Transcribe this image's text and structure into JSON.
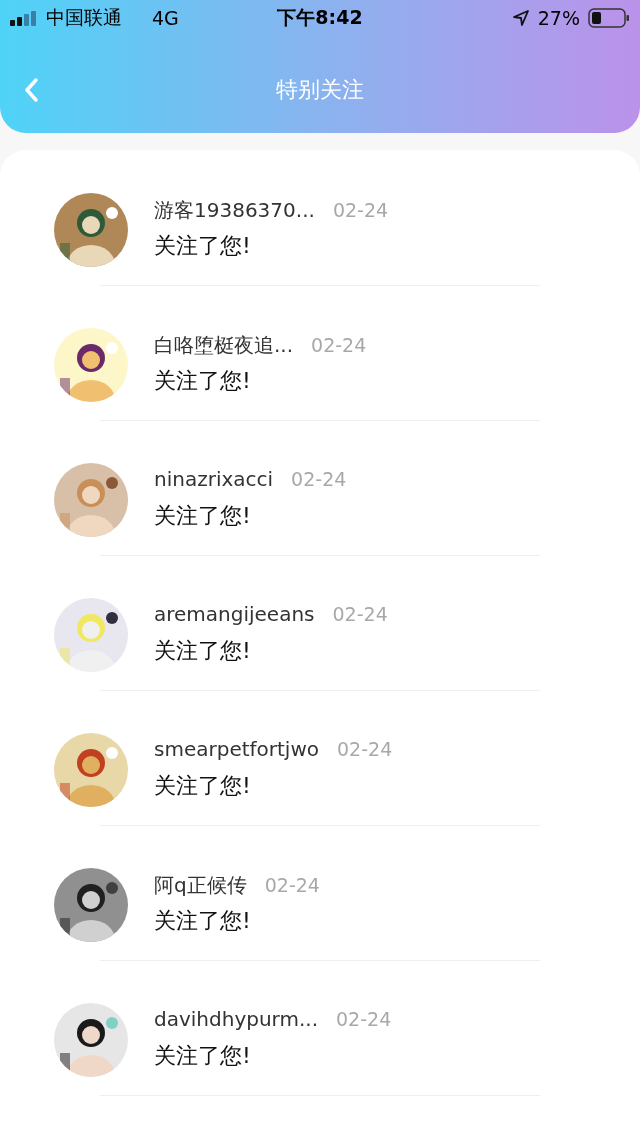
{
  "status_bar": {
    "carrier": "中国联通",
    "network": "4G",
    "time": "下午8:42",
    "battery": "27%"
  },
  "nav": {
    "title": "特别关注"
  },
  "items": [
    {
      "name": "游客19386370...",
      "date": "02-24",
      "message": "关注了您!"
    },
    {
      "name": "白咯堕梃夜追...",
      "date": "02-24",
      "message": "关注了您!"
    },
    {
      "name": "ninazrixacci",
      "date": "02-24",
      "message": "关注了您!"
    },
    {
      "name": "aremangijeeans",
      "date": "02-24",
      "message": "关注了您!"
    },
    {
      "name": "smearpetfortjwo",
      "date": "02-24",
      "message": "关注了您!"
    },
    {
      "name": "阿q正候传",
      "date": "02-24",
      "message": "关注了您!"
    },
    {
      "name": "davihdhypurm...",
      "date": "02-24",
      "message": "关注了您!"
    }
  ]
}
